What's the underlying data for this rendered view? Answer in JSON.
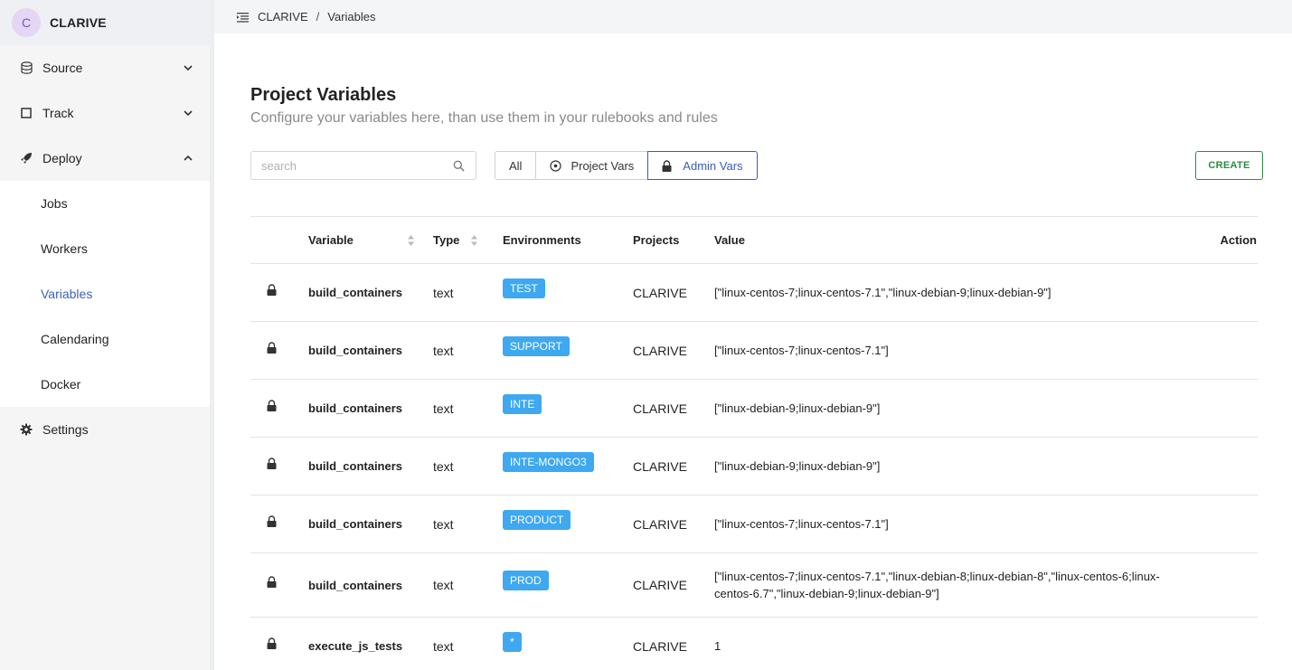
{
  "brand": {
    "avatar_letter": "C",
    "name": "CLARIVE"
  },
  "sidebar": {
    "items": [
      {
        "label": "Source",
        "icon": "database-icon",
        "expanded": false
      },
      {
        "label": "Track",
        "icon": "square-icon",
        "expanded": false
      },
      {
        "label": "Deploy",
        "icon": "rocket-icon",
        "expanded": true
      }
    ],
    "deploy_sub": [
      {
        "label": "Jobs"
      },
      {
        "label": "Workers"
      },
      {
        "label": "Variables",
        "active": true
      },
      {
        "label": "Calendaring"
      },
      {
        "label": "Docker"
      }
    ],
    "settings": {
      "label": "Settings",
      "icon": "gear-icon"
    }
  },
  "breadcrumb": {
    "root": "CLARIVE",
    "separator": "/",
    "current": "Variables"
  },
  "page": {
    "title": "Project Variables",
    "subtitle": "Configure your variables here, than use them in your rulebooks and rules"
  },
  "search": {
    "placeholder": "search",
    "value": ""
  },
  "filters": [
    {
      "label": "All",
      "icon": null,
      "active": false
    },
    {
      "label": "Project Vars",
      "icon": "target-icon",
      "active": false
    },
    {
      "label": "Admin Vars",
      "icon": "lock-icon",
      "active": true
    }
  ],
  "create_label": "CREATE",
  "table": {
    "headers": {
      "variable": "Variable",
      "type": "Type",
      "environments": "Environments",
      "projects": "Projects",
      "value": "Value",
      "action": "Action"
    },
    "rows": [
      {
        "variable": "build_containers",
        "type": "text",
        "environment": "TEST",
        "project": "CLARIVE",
        "value": "[\"linux-centos-7;linux-centos-7.1\",\"linux-debian-9;linux-debian-9\"]"
      },
      {
        "variable": "build_containers",
        "type": "text",
        "environment": "SUPPORT",
        "project": "CLARIVE",
        "value": "[\"linux-centos-7;linux-centos-7.1\"]"
      },
      {
        "variable": "build_containers",
        "type": "text",
        "environment": "INTE",
        "project": "CLARIVE",
        "value": "[\"linux-debian-9;linux-debian-9\"]"
      },
      {
        "variable": "build_containers",
        "type": "text",
        "environment": "INTE-MONGO3",
        "project": "CLARIVE",
        "value": "[\"linux-debian-9;linux-debian-9\"]"
      },
      {
        "variable": "build_containers",
        "type": "text",
        "environment": "PRODUCT",
        "project": "CLARIVE",
        "value": "[\"linux-centos-7;linux-centos-7.1\"]"
      },
      {
        "variable": "build_containers",
        "type": "text",
        "environment": "PROD",
        "project": "CLARIVE",
        "value": "[\"linux-centos-7;linux-centos-7.1\",\"linux-debian-8;linux-debian-8\",\"linux-centos-6;linux-centos-6.7\",\"linux-debian-9;linux-debian-9\"]"
      },
      {
        "variable": "execute_js_tests",
        "type": "text",
        "environment": "*",
        "project": "CLARIVE",
        "value": "1"
      }
    ]
  },
  "colors": {
    "accent": "#3b5bb8",
    "badge": "#3ea8f0",
    "create": "#2e8b3e",
    "avatar_bg": "#e4d6f5"
  }
}
